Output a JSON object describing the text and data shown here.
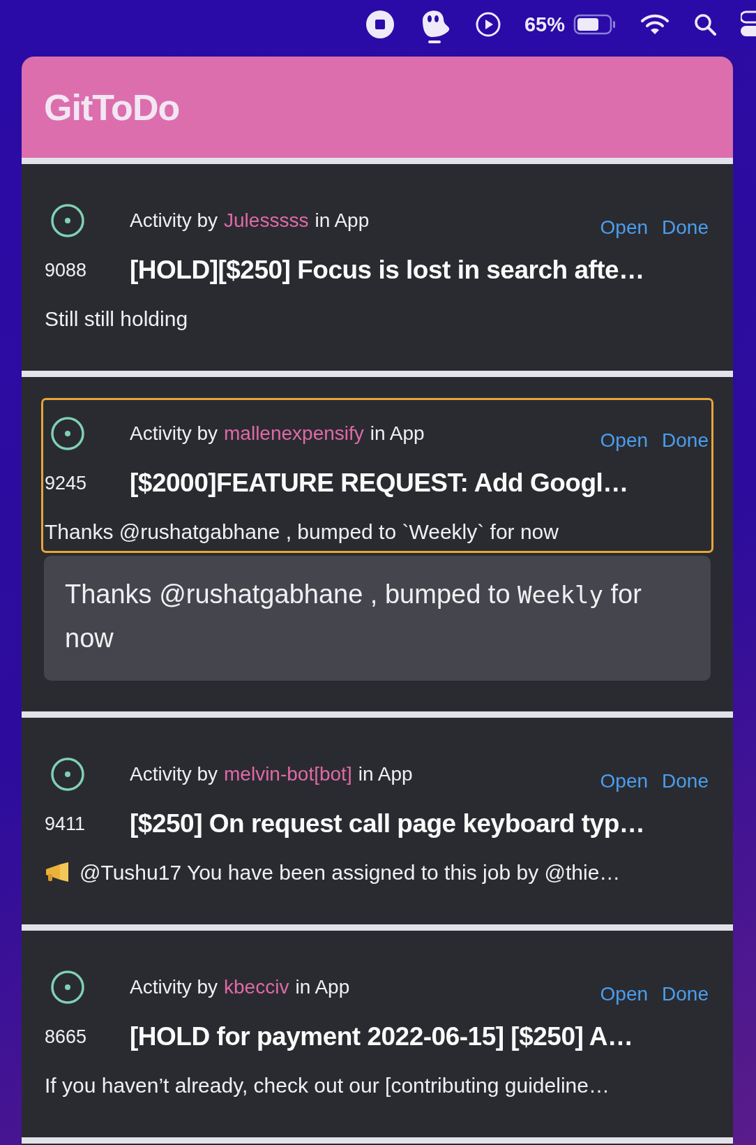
{
  "menu_bar": {
    "battery_percent": "65%"
  },
  "app": {
    "title": "GitToDo"
  },
  "items": [
    {
      "number": "9088",
      "activity_prefix": "Activity by",
      "author": "Julesssss",
      "activity_suffix": "in App",
      "title": "[HOLD][$250] Focus is lost in search afte…",
      "preview": "Still still holding",
      "actions": [
        "Open",
        "Done"
      ],
      "selected": false,
      "kind": "plain"
    },
    {
      "number": "9245",
      "activity_prefix": "Activity by",
      "author": "mallenexpensify",
      "activity_suffix": "in App",
      "title": "[$2000]FEATURE REQUEST: Add Googl…",
      "preview": "Thanks @rushatgabhane , bumped to `Weekly` for now",
      "actions": [
        "Open",
        "Done"
      ],
      "selected": true,
      "kind": "plain",
      "expanded_comment": [
        {
          "kind": "text",
          "text": "Thanks @rushatgabhane , bumped to "
        },
        {
          "kind": "code",
          "text": "Weekly"
        },
        {
          "kind": "text",
          "text": " for now"
        }
      ]
    },
    {
      "number": "9411",
      "activity_prefix": "Activity by",
      "author": "melvin-bot[bot]",
      "activity_suffix": "in App",
      "title": "[$250] On request call page keyboard typ…",
      "preview": "@Tushu17 You have been assigned to this job by @thie…",
      "actions": [
        "Open",
        "Done"
      ],
      "selected": false,
      "kind": "announcement"
    },
    {
      "number": "8665",
      "activity_prefix": "Activity by",
      "author": "kbecciv",
      "activity_suffix": "in App",
      "title": "[HOLD for payment 2022-06-15] [$250] A…",
      "preview": "If you haven’t already, check out our [contributing guideline…",
      "actions": [
        "Open",
        "Done"
      ],
      "selected": false,
      "kind": "plain"
    }
  ]
}
